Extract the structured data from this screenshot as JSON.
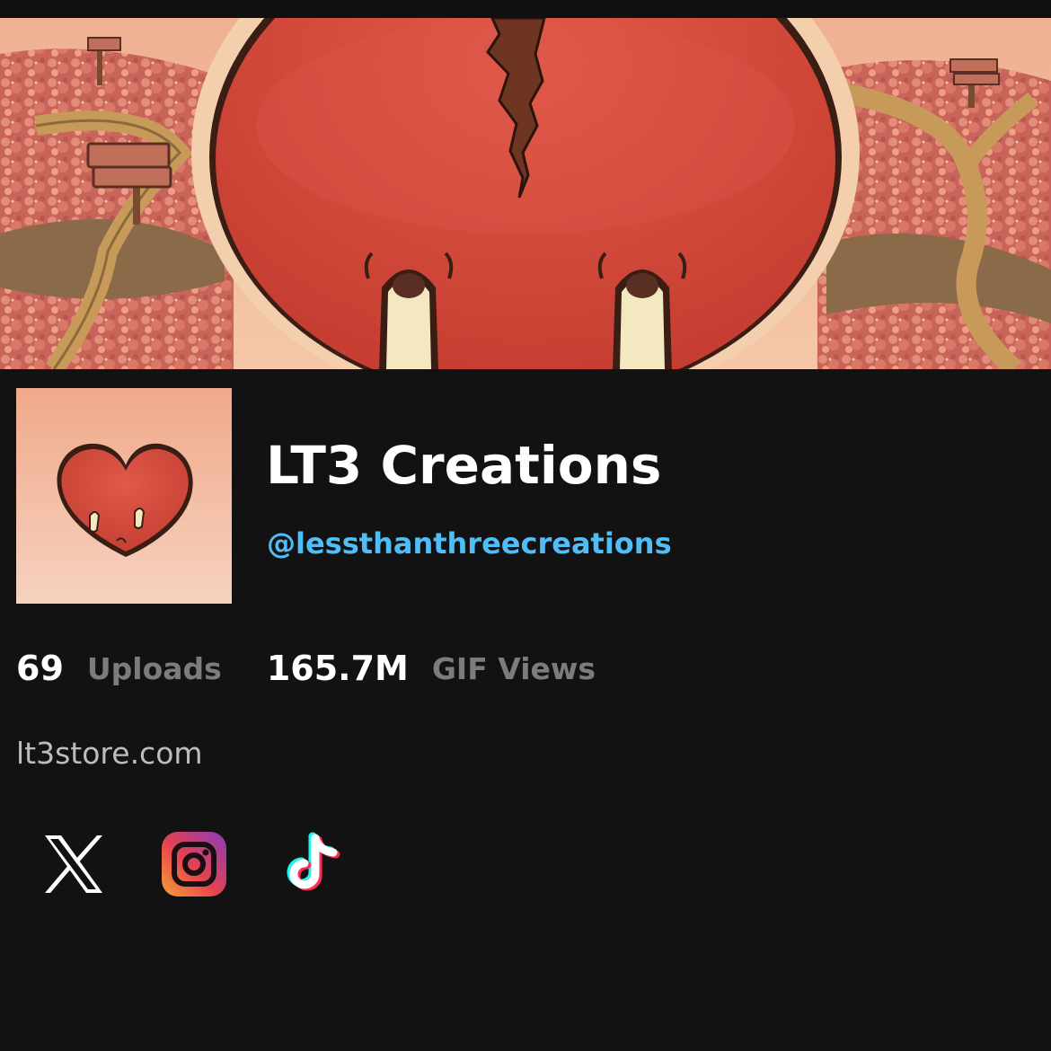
{
  "profile": {
    "display_name": "LT3 Creations",
    "username": "@lessthanthreecreations",
    "website": "lt3store.com"
  },
  "stats": [
    {
      "value": "69",
      "label": "Uploads"
    },
    {
      "value": "165.7M",
      "label": "GIF Views"
    }
  ],
  "social_links": [
    {
      "name": "x",
      "icon": "x-icon"
    },
    {
      "name": "instagram",
      "icon": "instagram-icon"
    },
    {
      "name": "tiktok",
      "icon": "tiktok-icon"
    }
  ],
  "colors": {
    "background": "#121212",
    "username": "#4fbdf6",
    "stat_label": "#7c7c7c",
    "website": "#bdbdbd",
    "heart_red": "#d9473a",
    "banner_peach": "#e9a486"
  }
}
